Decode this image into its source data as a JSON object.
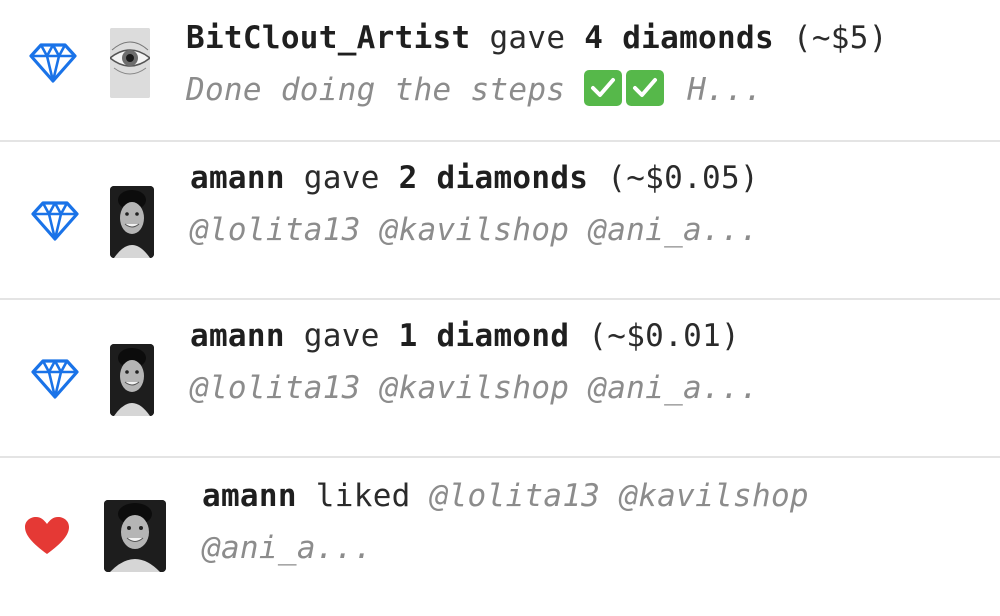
{
  "notifications": [
    {
      "type": "diamond",
      "icon": "diamond-icon",
      "user": "BitClout_Artist",
      "verb": "gave",
      "amount_label": "4 diamonds",
      "value": "(~$5)",
      "preview_before": "Done doing the steps",
      "preview_after": "H..."
    },
    {
      "type": "diamond",
      "icon": "diamond-icon",
      "user": "amann",
      "verb": "gave",
      "amount_label": "2 diamonds",
      "value": "(~$0.05)",
      "preview": "@lolita13 @kavilshop @ani_a..."
    },
    {
      "type": "diamond",
      "icon": "diamond-icon",
      "user": "amann",
      "verb": "gave",
      "amount_label": "1 diamond",
      "value": "(~$0.01)",
      "preview": "@lolita13 @kavilshop @ani_a..."
    },
    {
      "type": "like",
      "icon": "heart-icon",
      "user": "amann",
      "verb": "liked",
      "preview_inline": "@lolita13 @kavilshop",
      "preview": "@ani_a..."
    }
  ],
  "colors": {
    "diamond": "#1a73e8",
    "heart": "#e53935",
    "check": "#56b84a",
    "divider": "#e4e4e4"
  }
}
